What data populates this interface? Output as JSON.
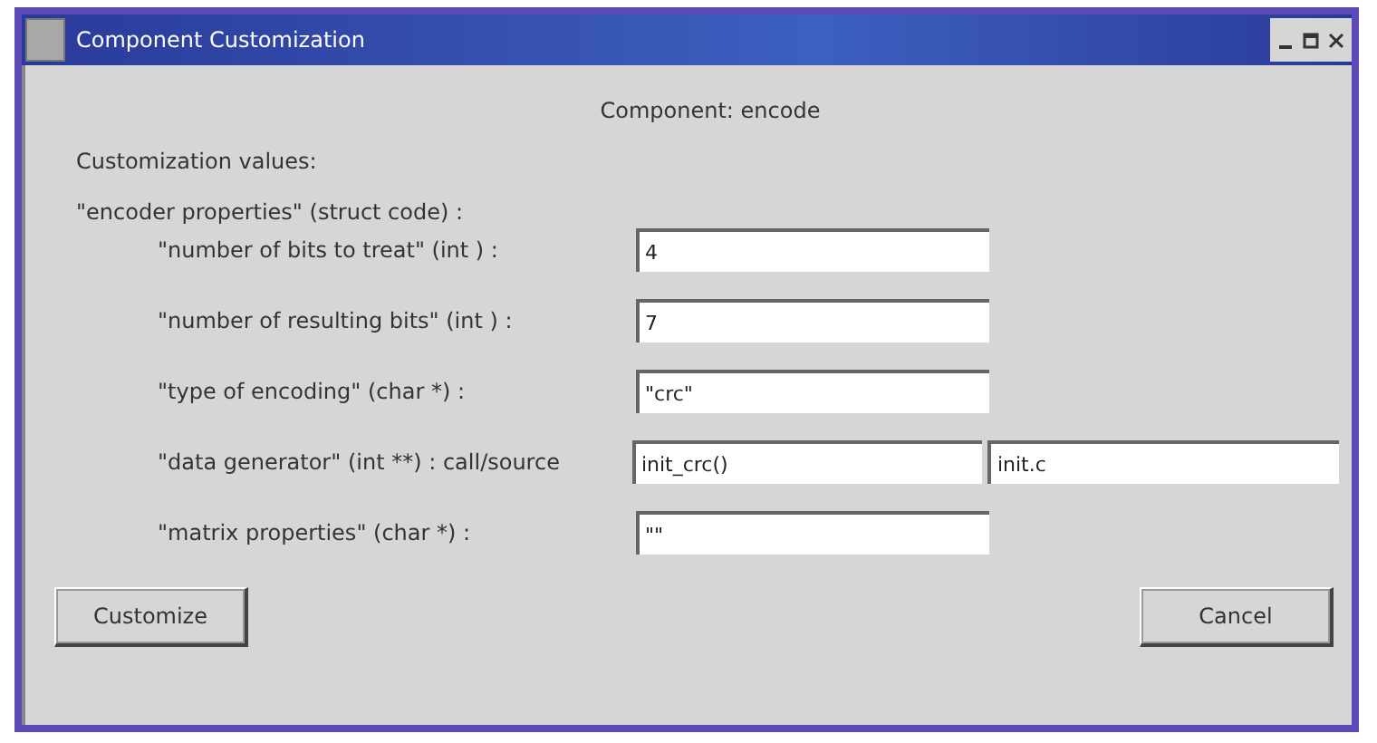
{
  "window": {
    "title": "Component Customization"
  },
  "heading": "Component: encode",
  "section": "Customization values:",
  "group": "\"encoder properties\" (struct code) :",
  "rows": [
    {
      "label": "\"number of bits to treat\" (int ) :",
      "values": [
        "4"
      ]
    },
    {
      "label": "\"number of resulting bits\" (int ) :",
      "values": [
        "7"
      ]
    },
    {
      "label": "\"type of encoding\" (char *) :",
      "values": [
        "\"crc\""
      ]
    },
    {
      "label": "\"data generator\" (int **) : call/source",
      "values": [
        "init_crc()",
        "init.c"
      ]
    },
    {
      "label": "\"matrix properties\" (char *) :",
      "values": [
        "\"\""
      ]
    }
  ],
  "buttons": [
    "Customize",
    "Cancel"
  ]
}
